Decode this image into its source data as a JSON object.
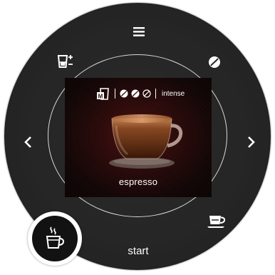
{
  "header": {
    "menu_icon": "menu-icon",
    "bean_icon": "coffee-bean-icon",
    "cup_size_icon": "cup-size-adjust-icon"
  },
  "nav": {
    "prev_icon": "chevron-left-icon",
    "next_icon": "chevron-right-icon"
  },
  "screen": {
    "mode_icon": "milk-m-icon",
    "strength_beans": 3,
    "strength_label": "intense",
    "drink_name": "espresso"
  },
  "controls": {
    "start_label": "start",
    "cup_icon": "cup-saucer-icon",
    "brew_icon": "hot-cup-icon"
  },
  "colors": {
    "dial": "#262626",
    "screen_glow": "#4a1010",
    "accent": "#ffffff"
  }
}
